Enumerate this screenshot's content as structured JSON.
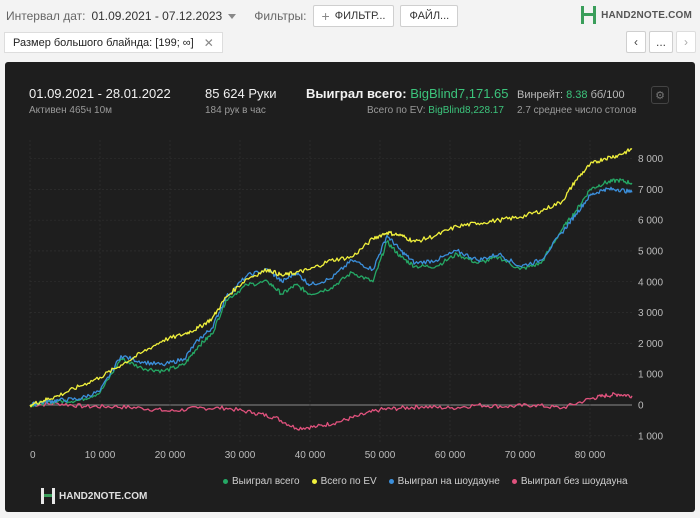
{
  "topbar": {
    "interval_label": "Интервал дат:",
    "interval_value": "01.09.2021 - 07.12.2023",
    "filters_label": "Фильтры:",
    "filters_button": "ФИЛЬТР...",
    "files_button": "ФАЙЛ...",
    "logo_text": "HAND2NOTE.COM"
  },
  "filter_chip": {
    "text": "Размер большого блайнда: [199; ∞]"
  },
  "nav": {
    "prev": "‹",
    "more": "...",
    "next": "›"
  },
  "stats": {
    "range": "01.09.2021 - 28.01.2022",
    "active": "Активен 465ч 10м",
    "hands": "85 624 Руки",
    "hands_per_hour": "184 рук в час",
    "won_total_label": "Выиграл всего:",
    "won_total_value": "BigBlind7,171.65",
    "ev_label": "Всего по EV:",
    "ev_value": "BigBlind8,228.17",
    "winrate_label": "Винрейт:",
    "winrate_value": "8.38",
    "winrate_unit": "бб/100",
    "tables": "2.7 среднее число столов"
  },
  "watermark": "HAND2NOTE.COM",
  "chart_data": {
    "type": "line",
    "x_ticks": [
      "0",
      "10 000",
      "20 000",
      "30 000",
      "40 000",
      "50 000",
      "60 000",
      "70 000",
      "80 000"
    ],
    "y_ticks": [
      "8 000",
      "7 000",
      "6 000",
      "5 000",
      "4 000",
      "3 000",
      "2 000",
      "1 000",
      "0",
      "1 000"
    ],
    "xlim": [
      0,
      86000
    ],
    "ylim": [
      -1200,
      8600
    ],
    "colors": {
      "won": "#25a865",
      "ev": "#f0f03c",
      "showdown": "#3b8fdb",
      "nonshowdown": "#e0527d"
    },
    "series": [
      {
        "name": "Выиграл всего",
        "key": "won",
        "x": [
          0,
          2000,
          4000,
          7000,
          10000,
          13000,
          16000,
          19000,
          22000,
          24000,
          26000,
          28000,
          31000,
          34000,
          36000,
          38000,
          40000,
          43000,
          46000,
          49000,
          51000,
          53000,
          55000,
          58000,
          61000,
          64000,
          67000,
          70000,
          73000,
          76000,
          78000,
          80000,
          82000,
          84000,
          86000
        ],
        "y": [
          0,
          80,
          120,
          150,
          400,
          1500,
          1200,
          1100,
          1300,
          1900,
          2300,
          3400,
          3900,
          4000,
          3600,
          3900,
          3600,
          3800,
          4300,
          4000,
          5300,
          4800,
          4500,
          4500,
          4900,
          4600,
          4800,
          4400,
          4600,
          5700,
          6300,
          7000,
          7200,
          7300,
          7200
        ]
      },
      {
        "name": "Всего по EV",
        "key": "ev",
        "x": [
          0,
          2000,
          4000,
          7000,
          10000,
          13000,
          16000,
          19000,
          22000,
          24000,
          26000,
          28000,
          31000,
          34000,
          36000,
          38000,
          40000,
          43000,
          46000,
          49000,
          51000,
          53000,
          55000,
          58000,
          61000,
          64000,
          67000,
          70000,
          73000,
          76000,
          78000,
          80000,
          82000,
          84000,
          86000
        ],
        "y": [
          0,
          150,
          300,
          600,
          900,
          1300,
          1700,
          2100,
          2300,
          2500,
          2800,
          3500,
          4100,
          4400,
          4200,
          4300,
          4400,
          4700,
          4800,
          5400,
          5600,
          5500,
          5300,
          5500,
          5800,
          5900,
          6000,
          6100,
          6300,
          6600,
          7300,
          7800,
          8000,
          8100,
          8300
        ]
      },
      {
        "name": "Выиграл на шоудауне",
        "key": "showdown",
        "x": [
          0,
          2000,
          4000,
          7000,
          10000,
          13000,
          16000,
          19000,
          22000,
          24000,
          26000,
          28000,
          31000,
          34000,
          36000,
          38000,
          40000,
          43000,
          46000,
          49000,
          51000,
          53000,
          55000,
          58000,
          61000,
          64000,
          67000,
          70000,
          73000,
          76000,
          78000,
          80000,
          82000,
          84000,
          86000
        ],
        "y": [
          0,
          100,
          150,
          200,
          450,
          1600,
          1400,
          1300,
          1500,
          2100,
          2500,
          3500,
          4200,
          4400,
          4000,
          4300,
          3900,
          4100,
          4700,
          4400,
          5500,
          5000,
          4600,
          4700,
          5000,
          4700,
          4900,
          4500,
          4700,
          5600,
          6200,
          6800,
          7000,
          7000,
          6900
        ]
      },
      {
        "name": "Выиграл без шоудауна",
        "key": "nonshowdown",
        "x": [
          0,
          4000,
          8000,
          12000,
          16000,
          20000,
          24000,
          28000,
          32000,
          35000,
          38000,
          41000,
          44000,
          47000,
          50000,
          53000,
          56000,
          60000,
          64000,
          68000,
          72000,
          76000,
          80000,
          82000,
          84000,
          86000
        ],
        "y": [
          0,
          50,
          -50,
          -50,
          -100,
          -200,
          -100,
          -100,
          -250,
          -400,
          -750,
          -700,
          -550,
          -350,
          -150,
          -100,
          -50,
          -100,
          0,
          -50,
          0,
          -100,
          200,
          300,
          350,
          300
        ]
      }
    ]
  }
}
